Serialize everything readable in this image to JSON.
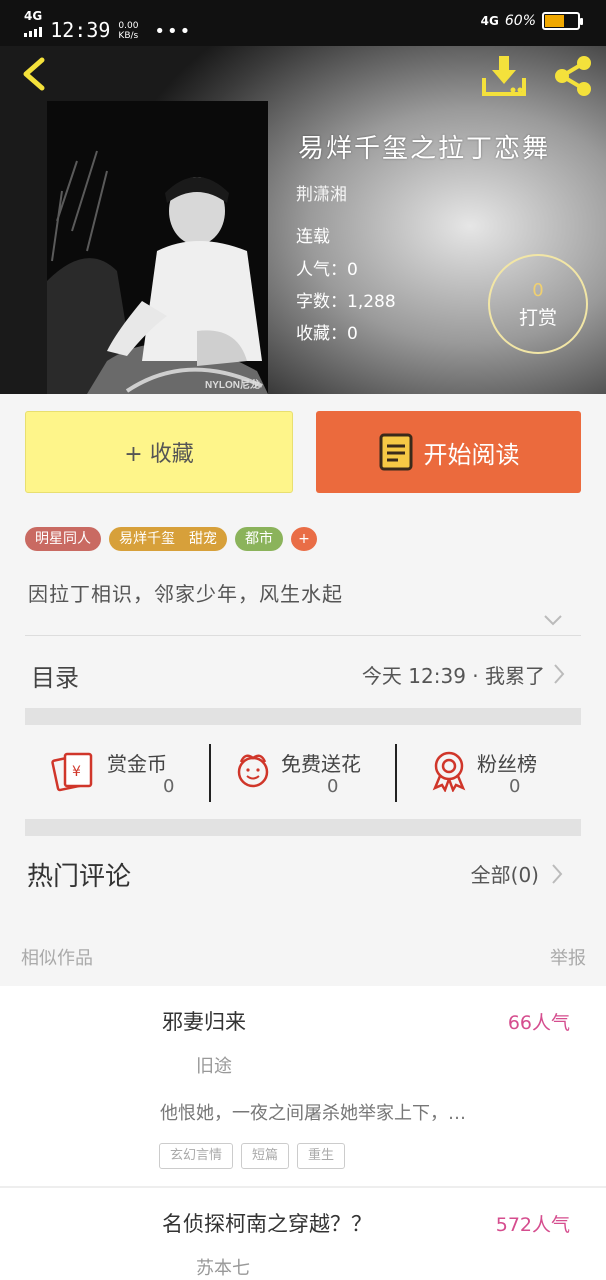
{
  "status_bar": {
    "network": "4G",
    "time": "12:39",
    "speed": "0.00 KB/s",
    "dots": "•••",
    "network_right": "4G",
    "battery_text": "60%",
    "battery_level": 0.6
  },
  "hero": {
    "title": "易烊千玺之拉丁恋舞",
    "author": "荆潇湘",
    "status": "连载",
    "popularity": "人气：0",
    "word_count": "字数：1,288",
    "favorites": "收藏：0",
    "tip_count": "0",
    "tip_label": "打赏",
    "cover_caption": "NYLON尼龙"
  },
  "actions": {
    "collect_label": "+ 收藏",
    "read_label": "开始阅读"
  },
  "tags": [
    {
      "label": "明星同人",
      "color": "#c96a62"
    },
    {
      "label": "易烊千玺　甜宠",
      "color": "#d7a03a"
    },
    {
      "label": "都市",
      "color": "#8bb35b"
    }
  ],
  "tag_more": "+",
  "summary": "因拉丁相识，邻家少年，风生水起",
  "toc": {
    "label": "目录",
    "latest": "今天 12:39 · 我累了"
  },
  "stats": [
    {
      "label": "赏金币",
      "value": "0",
      "icon": "red-envelope-icon"
    },
    {
      "label": "免费送花",
      "value": "0",
      "icon": "flower-icon"
    },
    {
      "label": "粉丝榜",
      "value": "0",
      "icon": "medal-icon"
    }
  ],
  "hot_comments": {
    "label": "热门评论",
    "all": "全部(0)"
  },
  "similar": {
    "label": "相似作品",
    "report": "举报",
    "items": [
      {
        "title": "邪妻归来",
        "popularity": "66人气",
        "author": "旧途",
        "desc": "他恨她，一夜之间屠杀她举家上下，…",
        "tags": [
          "玄幻言情",
          "短篇",
          "重生"
        ]
      },
      {
        "title": "名侦探柯南之穿越？？",
        "popularity": "572人气",
        "author": "苏本七"
      }
    ]
  },
  "colors": {
    "accent_orange": "#eb6a3d",
    "collect_yellow": "#fef58a",
    "popularity_pink": "#d54d8e",
    "icon_red": "#d0362a"
  }
}
